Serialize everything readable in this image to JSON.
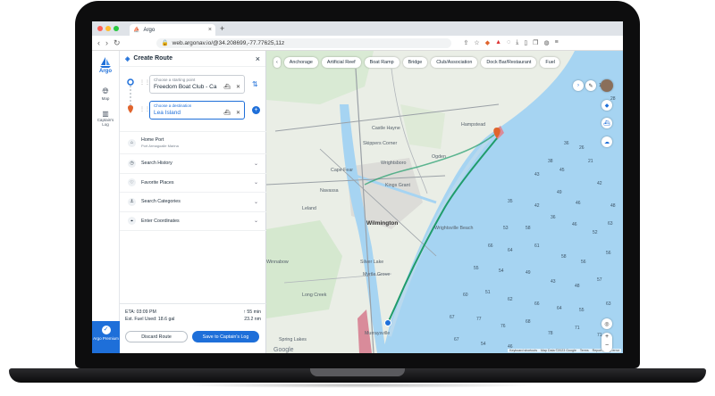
{
  "browser": {
    "tab_title": "Argo",
    "tab_close": "×",
    "new_tab": "+",
    "url": "web.argonav.io/@34.208699,-77.77625,11z",
    "back": "‹",
    "forward": "›",
    "reload": "↻",
    "dot_colors": [
      "#ff5f57",
      "#febc2e",
      "#28c840"
    ]
  },
  "rail": {
    "brand": "Argo",
    "items": [
      {
        "label": "Map",
        "icon": "globe-icon"
      },
      {
        "label": "Captain's Log",
        "icon": "book-icon"
      }
    ],
    "premium_label": "Argo Premium"
  },
  "panel": {
    "title": "Create Route",
    "close": "×",
    "start": {
      "label": "Choose a starting point",
      "value": "Freedom Boat Club - Ca"
    },
    "destination": {
      "label": "Choose a destination",
      "value": "Lea Island"
    },
    "home": {
      "title": "Home Port",
      "subtitle": "Port Armagoalle Marina"
    },
    "rows": [
      {
        "label": "Search History",
        "icon": "clock-icon"
      },
      {
        "label": "Favorite Places",
        "icon": "heart-icon"
      },
      {
        "label": "Search Categories",
        "icon": "anchor-icon"
      },
      {
        "label": "Enter Coordinates",
        "icon": "crosshair-icon"
      }
    ],
    "footer": {
      "eta": "ETA: 03:09 PM",
      "duration": "↑ 55 min",
      "fuel": "Est. Fuel Used: 18.6 gal",
      "distance": "23.2 nm",
      "discard": "Discard Route",
      "save": "Save to Captain's Log"
    }
  },
  "map": {
    "chips": [
      "Anchorage",
      "Artificial Reef",
      "Boat Ramp",
      "Bridge",
      "Club/Association",
      "Dock Bar/Restaurant",
      "Fuel"
    ],
    "places": [
      "Castle Hayne",
      "Skippers Corner",
      "Hampstead",
      "Wrightsboro",
      "Ogden",
      "Cape Fear",
      "Navassa",
      "Kings Grant",
      "Wilmington",
      "Silver Lake",
      "Winnabow",
      "Myrtle Grove",
      "Spring Lakes",
      "Murraysville",
      "Leland",
      "Wrightsville Beach",
      "Long Creek"
    ],
    "footer": [
      "Keyboard shortcuts",
      "Map Data ©2023 Google",
      "Terms",
      "Report a map error"
    ],
    "depths": [
      "17",
      "28",
      "36",
      "26",
      "38",
      "43",
      "45",
      "21",
      "35",
      "42",
      "49",
      "46",
      "42",
      "48",
      "53",
      "58",
      "36",
      "46",
      "52",
      "63",
      "66",
      "64",
      "61",
      "58",
      "56",
      "56",
      "55",
      "54",
      "49",
      "43",
      "48",
      "57",
      "60",
      "51",
      "62",
      "66",
      "64",
      "55",
      "63",
      "67",
      "77",
      "76",
      "68",
      "78",
      "71",
      "71",
      "67",
      "54",
      "46"
    ],
    "accent": "#1e6fd9",
    "water": "#a6d4f2",
    "route": "#1f9c6b"
  }
}
